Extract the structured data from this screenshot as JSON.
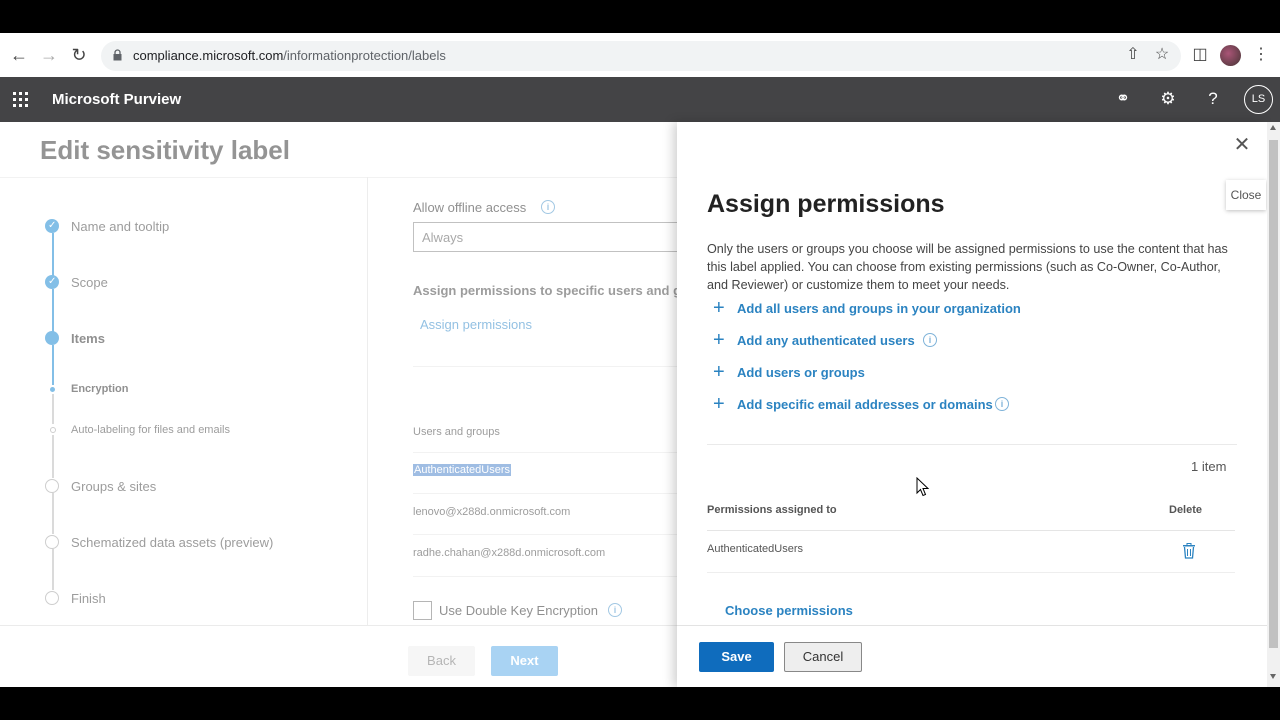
{
  "browser": {
    "url_domain": "compliance.microsoft.com",
    "url_path": "/informationprotection/labels"
  },
  "appbar": {
    "title": "Microsoft Purview",
    "user_initials": "LS"
  },
  "page": {
    "title": "Edit sensitivity label"
  },
  "steps": [
    {
      "label": "Name and tooltip",
      "state": "done"
    },
    {
      "label": "Scope",
      "state": "done"
    },
    {
      "label": "Items",
      "state": "current"
    },
    {
      "label": "Encryption",
      "state": "current-sub"
    },
    {
      "label": "Auto-labeling for files and emails",
      "state": "sub"
    },
    {
      "label": "Groups & sites",
      "state": "pending"
    },
    {
      "label": "Schematized data assets (preview)",
      "state": "pending"
    },
    {
      "label": "Finish",
      "state": "pending"
    }
  ],
  "middle": {
    "offline_label": "Allow offline access",
    "offline_value": "Always",
    "assign_heading": "Assign permissions to specific users and gr",
    "assign_link": "Assign permissions",
    "users_groups_header": "Users and groups",
    "users": [
      "AuthenticatedUsers",
      "lenovo@x288d.onmicrosoft.com",
      "radhe.chahan@x288d.onmicrosoft.com"
    ],
    "double_key_label": "Use Double Key Encryption"
  },
  "footer": {
    "back_label": "Back",
    "next_label": "Next"
  },
  "panel": {
    "close_tooltip": "Close",
    "title": "Assign permissions",
    "description": "Only the users or groups you choose will be assigned permissions to use the content that has this label applied. You can choose from existing permissions (such as Co-Owner, Co-Author, and Reviewer) or customize them to meet your needs.",
    "add_options": [
      "Add all users and groups in your organization",
      "Add any authenticated users",
      "Add users or groups",
      "Add specific email addresses or domains"
    ],
    "item_count": "1 item",
    "table_header_permissions": "Permissions assigned to",
    "table_header_delete": "Delete",
    "rows": [
      "AuthenticatedUsers"
    ],
    "choose_permissions": "Choose permissions",
    "save_label": "Save",
    "cancel_label": "Cancel"
  },
  "colors": {
    "accent": "#0f6cbd",
    "link": "#2b83c1",
    "appbar": "#444446"
  }
}
